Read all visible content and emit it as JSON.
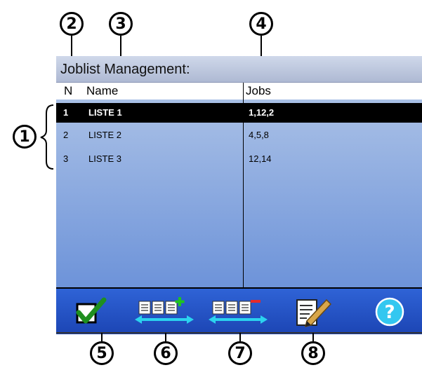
{
  "callouts": {
    "c1": "1",
    "c2": "2",
    "c3": "3",
    "c4": "4",
    "c5": "5",
    "c6": "6",
    "c7": "7",
    "c8": "8"
  },
  "window": {
    "title": "Joblist Management:"
  },
  "table": {
    "headers": {
      "n": "N",
      "name": "Name",
      "jobs": "Jobs"
    },
    "rows": [
      {
        "n": "1",
        "name": "LISTE 1",
        "jobs": "1,12,2",
        "selected": true
      },
      {
        "n": "2",
        "name": "LISTE 2",
        "jobs": "4,5,8",
        "selected": false
      },
      {
        "n": "3",
        "name": "LISTE 3",
        "jobs": "12,14",
        "selected": false
      }
    ]
  },
  "toolbar": {
    "buttons": [
      {
        "icon": "checkbox-check-icon"
      },
      {
        "icon": "add-list-icon"
      },
      {
        "icon": "remove-list-icon"
      },
      {
        "icon": "edit-notepad-icon"
      },
      {
        "icon": "help-icon",
        "glyph": "?"
      }
    ]
  },
  "colors": {
    "grid_top": "#a9c0e6",
    "grid_bottom": "#6d93d9",
    "toolbar": "#2f63d6",
    "check": "#1f8f1f",
    "plus": "#1ec51e",
    "minus": "#e52a2a",
    "arrow": "#2bd3ef",
    "help": "#33c7f0"
  }
}
